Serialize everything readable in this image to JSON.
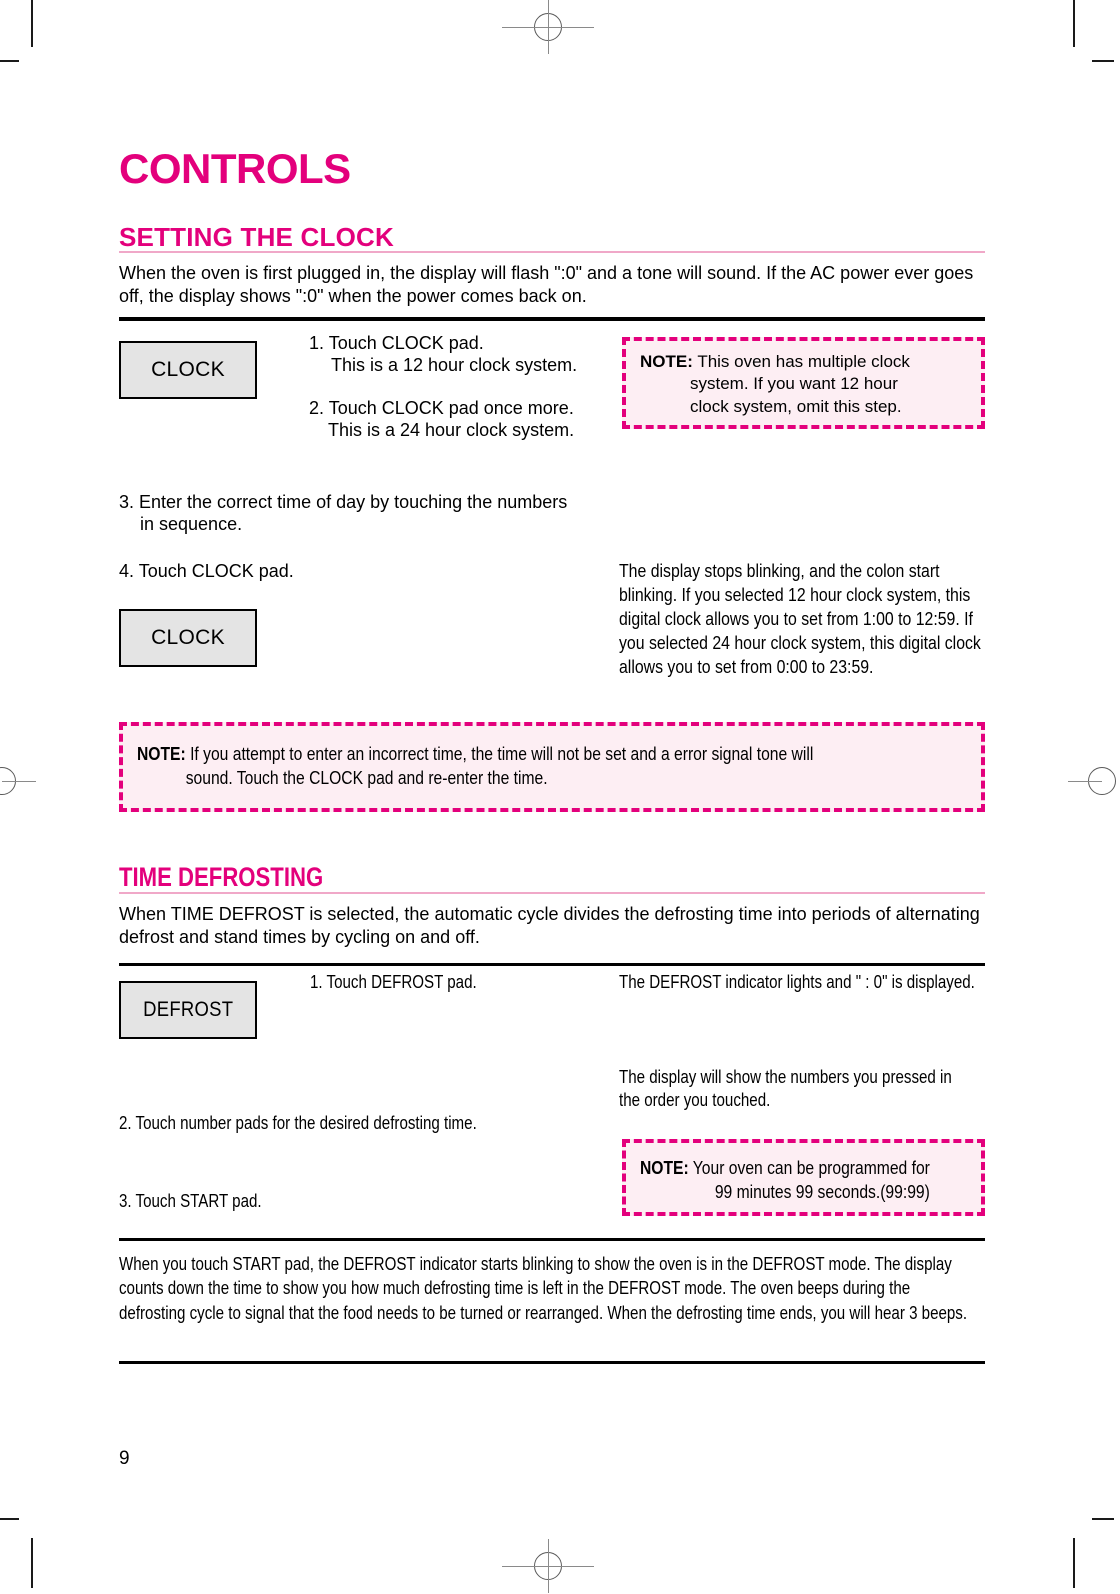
{
  "document": {
    "title": "CONTROLS",
    "page_number": "9"
  },
  "colors": {
    "accent": "#e3007c",
    "rule_pink": "#f0a8c8",
    "note_fill": "#fdeef3",
    "pad_fill": "#e4e4e4"
  },
  "sections": [
    {
      "heading": "SETTING THE CLOCK",
      "intro": "When the oven is first plugged in, the display will flash \":0\" and a tone will sound. If the AC power ever goes off, the display shows \":0\" when the power  comes back on.",
      "pads": [
        {
          "label": "CLOCK"
        },
        {
          "label": "CLOCK"
        }
      ],
      "steps": [
        "1. Touch CLOCK pad.",
        "This is a 12 hour clock system.",
        "2. Touch CLOCK pad once more.",
        "This is a 24 hour clock system.",
        "3. Enter the correct time of day by touching the numbers",
        "in sequence.",
        "4. Touch CLOCK pad."
      ],
      "result_text": "The display stops blinking, and the colon start blinking. If you selected 12 hour clock system, this digital clock allows you to set from 1:00 to 12:59. If you selected 24 hour clock system, this digital clock allows you to set from 0:00 to 23:59.",
      "note_small": {
        "label": "NOTE:",
        "lines": [
          "This oven has multiple clock",
          "system. If you want 12 hour",
          "clock system, omit this step."
        ]
      },
      "note_wide": {
        "label": "NOTE:",
        "lines": [
          "If you attempt to enter an incorrect time, the time will not be set and a error signal tone will",
          "sound. Touch the CLOCK pad and re-enter the time."
        ]
      }
    },
    {
      "heading": "TIME DEFROSTING",
      "intro": "When TIME DEFROST is selected, the automatic cycle divides the defrosting time into periods of alternating defrost and stand times by cycling on and off.",
      "pads": [
        {
          "label": "DEFROST"
        }
      ],
      "steps": [
        "1. Touch DEFROST pad.",
        "2. Touch number pads for the desired defrosting time.",
        "3. Touch START pad."
      ],
      "results": [
        "The DEFROST indicator lights and \" : 0\" is displayed.",
        "The display will show the numbers you pressed in the order you touched."
      ],
      "note_small": {
        "label": "NOTE:",
        "lines": [
          "Your oven can be programmed for",
          "99 minutes 99 seconds.(99:99)"
        ]
      },
      "closing": "When you touch START pad, the DEFROST indicator starts blinking to show the oven is in the DEFROST mode. The display counts down the time to show you how much defrosting time is left in the DEFROST mode. The oven beeps during the defrosting cycle to signal that the food needs to be turned or rearranged. When the defrosting time ends, you will hear 3 beeps."
    }
  ]
}
